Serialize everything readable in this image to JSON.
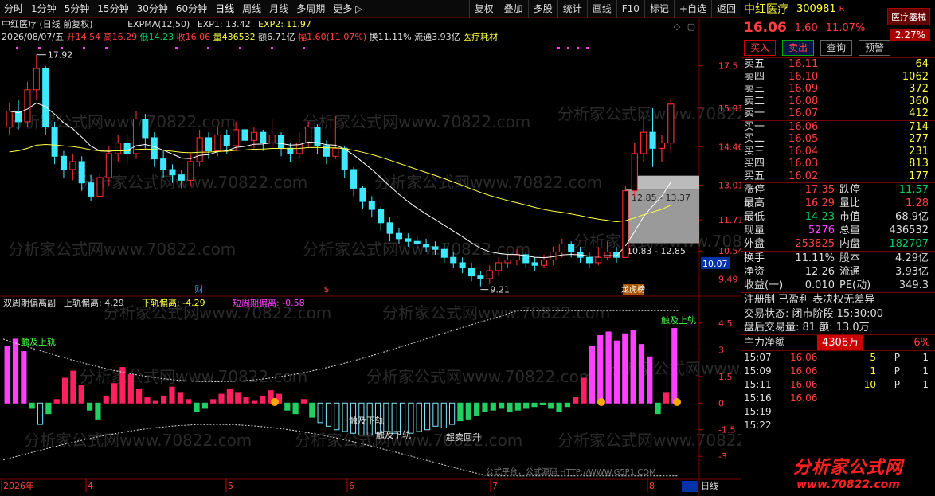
{
  "toolbar": {
    "left": [
      "分时",
      "1分钟",
      "5分钟",
      "15分钟",
      "30分钟",
      "60分钟",
      "日线",
      "周线",
      "月线",
      "多周期",
      "更多 ▷"
    ],
    "active_index": 6,
    "right": [
      "复权",
      "叠加",
      "多股",
      "统计",
      "画线",
      "F10",
      "标记",
      "+自选",
      "返回"
    ]
  },
  "info": {
    "title": "中红医疗 (日线 前复权)",
    "ema_label": "EXPMA(12,50)",
    "exp1": "EXP1: 13.42",
    "exp2": "EXP2: 11.97",
    "date": "2026/08/07/五",
    "open": "开14.54",
    "high": "高16.29",
    "low": "低14.23",
    "close": "收16.06",
    "vol": "量436532",
    "amount": "额6.71亿",
    "change": "幅1.60(11.07%)",
    "turnover": "换11.11%",
    "float": "流通3.93亿",
    "sector": "医疗耗材"
  },
  "chart_data": [
    {
      "type": "candlestick",
      "title": "",
      "price_axis": [
        17.5,
        15.91,
        14.46,
        13.01,
        11.71,
        10.54,
        9.49
      ],
      "ylim": [
        8.9,
        18.3
      ],
      "current_price_label": "10.07",
      "annotations": {
        "high_label": "17.92",
        "low_label": "9.21",
        "box_upper": "12.85 - 13.37",
        "box_lower": "10.83 - 12.85",
        "marks": [
          "财",
          "$",
          "龙虎榜"
        ]
      },
      "series": [
        {
          "name": "EXP1",
          "color": "#ffffff"
        },
        {
          "name": "EXP2",
          "color": "#ffff40"
        }
      ],
      "candles": [
        [
          15.2,
          15.8,
          16.1,
          14.9
        ],
        [
          15.8,
          15.4,
          16.2,
          15.1
        ],
        [
          15.4,
          16.6,
          16.9,
          15.2
        ],
        [
          16.6,
          17.4,
          17.92,
          16.2
        ],
        [
          17.4,
          15.2,
          17.5,
          14.9
        ],
        [
          15.2,
          14.1,
          15.4,
          13.8
        ],
        [
          14.1,
          13.6,
          14.3,
          13.3
        ],
        [
          13.6,
          13.9,
          14.2,
          13.2
        ],
        [
          13.9,
          13.1,
          14.1,
          12.8
        ],
        [
          13.1,
          12.6,
          13.4,
          12.4
        ],
        [
          12.6,
          13.3,
          13.5,
          12.4
        ],
        [
          13.3,
          14.2,
          14.5,
          13.0
        ],
        [
          14.2,
          14.6,
          14.9,
          13.9
        ],
        [
          14.6,
          14.2,
          14.9,
          13.8
        ],
        [
          14.2,
          15.5,
          15.8,
          14.0
        ],
        [
          15.5,
          14.8,
          15.7,
          14.4
        ],
        [
          14.8,
          14.0,
          15.0,
          13.7
        ],
        [
          14.0,
          13.6,
          14.3,
          13.3
        ],
        [
          13.6,
          13.4,
          13.8,
          13.1
        ],
        [
          13.4,
          13.2,
          13.6,
          12.9
        ],
        [
          13.2,
          13.9,
          14.2,
          13.0
        ],
        [
          13.9,
          14.8,
          15.1,
          13.7
        ],
        [
          14.8,
          14.3,
          15.0,
          14.0
        ],
        [
          14.3,
          14.9,
          15.2,
          14.1
        ],
        [
          14.9,
          14.5,
          15.1,
          14.2
        ],
        [
          14.5,
          15.1,
          15.4,
          14.3
        ],
        [
          15.1,
          14.7,
          15.3,
          14.4
        ],
        [
          14.7,
          15.0,
          15.2,
          14.4
        ],
        [
          15.0,
          14.6,
          15.1,
          14.3
        ],
        [
          14.6,
          14.9,
          15.5,
          14.4
        ],
        [
          14.9,
          14.4,
          15.0,
          14.1
        ],
        [
          14.4,
          14.2,
          14.6,
          13.9
        ],
        [
          14.2,
          14.6,
          15.0,
          14.0
        ],
        [
          14.6,
          15.2,
          15.4,
          14.4
        ],
        [
          15.2,
          14.5,
          15.3,
          14.2
        ],
        [
          14.5,
          14.1,
          14.7,
          13.8
        ],
        [
          14.1,
          14.4,
          15.6,
          14.0
        ],
        [
          14.4,
          13.6,
          14.5,
          13.3
        ],
        [
          13.6,
          12.9,
          13.7,
          12.6
        ],
        [
          12.9,
          12.4,
          13.0,
          12.1
        ],
        [
          12.4,
          12.1,
          12.6,
          11.8
        ],
        [
          12.1,
          11.6,
          12.2,
          11.3
        ],
        [
          11.6,
          11.2,
          11.8,
          10.9
        ],
        [
          11.2,
          11.0,
          11.4,
          10.8
        ],
        [
          11.0,
          10.9,
          11.2,
          10.7
        ],
        [
          10.9,
          10.8,
          11.1,
          10.6
        ],
        [
          10.8,
          10.7,
          11.0,
          10.5
        ],
        [
          10.7,
          10.6,
          10.9,
          10.4
        ],
        [
          10.6,
          10.3,
          10.8,
          10.1
        ],
        [
          10.3,
          10.1,
          10.5,
          9.9
        ],
        [
          10.1,
          9.9,
          10.3,
          9.7
        ],
        [
          9.9,
          9.6,
          10.1,
          9.4
        ],
        [
          9.6,
          9.5,
          9.8,
          9.21
        ],
        [
          9.5,
          9.8,
          10.0,
          9.3
        ],
        [
          9.8,
          10.1,
          10.3,
          9.6
        ],
        [
          10.1,
          10.2,
          10.4,
          9.9
        ],
        [
          10.2,
          10.4,
          10.6,
          10.0
        ],
        [
          10.4,
          10.1,
          10.5,
          9.9
        ],
        [
          10.1,
          10.0,
          10.3,
          9.8
        ],
        [
          10.0,
          10.2,
          10.4,
          9.9
        ],
        [
          10.2,
          10.5,
          10.7,
          10.0
        ],
        [
          10.5,
          10.8,
          11.0,
          10.3
        ],
        [
          10.8,
          10.5,
          10.9,
          10.3
        ],
        [
          10.5,
          10.3,
          10.7,
          10.1
        ],
        [
          10.3,
          10.1,
          10.5,
          9.9
        ],
        [
          10.1,
          10.3,
          10.7,
          10.0
        ],
        [
          10.3,
          10.5,
          10.9,
          10.2
        ],
        [
          10.5,
          10.3,
          10.7,
          10.1
        ],
        [
          10.3,
          12.8,
          13.0,
          10.9
        ],
        [
          12.8,
          14.2,
          14.6,
          12.6
        ],
        [
          14.2,
          15.0,
          15.6,
          13.9
        ],
        [
          15.0,
          14.4,
          15.9,
          13.7
        ],
        [
          14.4,
          14.6,
          14.9,
          13.9
        ],
        [
          14.6,
          16.06,
          16.29,
          14.23
        ]
      ]
    },
    {
      "type": "bar",
      "title": "双周期偏离副",
      "legend": [
        "上轨偏离: 4.29",
        "下轨偏离: -4.29",
        "短周期偏离: -0.58"
      ],
      "y_axis": [
        4.5,
        3.0,
        1.5,
        0.0,
        -1.5,
        -3.0
      ],
      "ylim": [
        -4.2,
        5.3
      ],
      "annotations": [
        "触及上轨",
        "触及下轨",
        "触及下轨",
        "超卖回升",
        "触及上轨"
      ],
      "values": [
        3.2,
        3.6,
        2.9,
        -0.3,
        -1.2,
        -0.6,
        0.2,
        1.4,
        1.8,
        1.0,
        -0.4,
        -0.9,
        0.4,
        1.1,
        2.0,
        1.6,
        0.8,
        0.3,
        0.1,
        0.4,
        0.9,
        0.6,
        0.2,
        -0.5,
        -0.3,
        0.2,
        0.5,
        0.8,
        0.6,
        0.3,
        0.1,
        0.4,
        0.7,
        0.5,
        -0.4,
        -0.6,
        0.2,
        -0.8,
        -1.1,
        -1.3,
        -1.5,
        -1.6,
        -1.7,
        -1.8,
        -1.8,
        -1.7,
        -1.6,
        -1.7,
        -1.8,
        -1.7,
        -1.6,
        -1.5,
        -1.3,
        -1.4,
        -1.2,
        -1.0,
        -0.9,
        -0.7,
        -0.5,
        -0.4,
        -0.3,
        -0.5,
        -0.4,
        -0.3,
        -0.2,
        -0.1,
        -0.3,
        -0.5,
        -0.2,
        0.3,
        1.4,
        3.2,
        3.8,
        4.0,
        3.5,
        3.9,
        4.1,
        3.3,
        2.6,
        -0.6,
        0.6,
        4.2
      ]
    }
  ],
  "bottom_axis": {
    "labels": [
      "2026年",
      "4",
      "5",
      "6",
      "7",
      "8"
    ],
    "period": "日线"
  },
  "watermark": "分析家公式网www.70822.com",
  "footer_watermark": "公式平台，公式源码  HTTP://WWW.G5P1.COM",
  "right_panel": {
    "name": "中红医疗",
    "code": "300981",
    "flag": "R",
    "industry": "医疗器械",
    "industry_pct": "2.27%",
    "price": "16.06",
    "change": "1.60",
    "change_pct": "11.07%",
    "buttons": [
      "买入",
      "卖出",
      "查询",
      "预警"
    ],
    "asks": [
      {
        "label": "卖五",
        "price": "16.11",
        "vol": "64"
      },
      {
        "label": "卖四",
        "price": "16.10",
        "vol": "1062"
      },
      {
        "label": "卖三",
        "price": "16.09",
        "vol": "372"
      },
      {
        "label": "卖二",
        "price": "16.08",
        "vol": "360"
      },
      {
        "label": "卖一",
        "price": "16.07",
        "vol": "412"
      }
    ],
    "bids": [
      {
        "label": "买一",
        "price": "16.06",
        "vol": "714"
      },
      {
        "label": "买二",
        "price": "16.05",
        "vol": "277"
      },
      {
        "label": "买三",
        "price": "16.04",
        "vol": "231"
      },
      {
        "label": "买四",
        "price": "16.03",
        "vol": "813"
      },
      {
        "label": "买五",
        "price": "16.02",
        "vol": "177"
      }
    ],
    "stats": [
      {
        "k": "涨停",
        "v": "17.35",
        "vc": "#ff4040",
        "k2": "跌停",
        "v2": "11.57",
        "v2c": "#00d060"
      },
      {
        "k": "最高",
        "v": "16.29",
        "vc": "#ff4040",
        "k2": "量比",
        "v2": "1.28",
        "v2c": "#ff4040"
      },
      {
        "k": "最低",
        "v": "14.23",
        "vc": "#00d060",
        "k2": "市值",
        "v2": "68.9亿",
        "v2c": "#dddddd"
      },
      {
        "k": "现量",
        "v": "5276",
        "vc": "#ff40ff",
        "k2": "总量",
        "v2": "436532",
        "v2c": "#dddddd"
      },
      {
        "k": "外盘",
        "v": "253825",
        "vc": "#ff4040",
        "k2": "内盘",
        "v2": "182707",
        "v2c": "#00d060"
      }
    ],
    "stats2": [
      {
        "k": "换手",
        "v": "11.11%",
        "k2": "股本",
        "v2": "4.29亿"
      },
      {
        "k": "净资",
        "v": "12.26",
        "k2": "流通",
        "v2": "3.93亿"
      },
      {
        "k": "收益(一)",
        "v": "0.010",
        "k2": "PE(动)",
        "v2": "349.3"
      }
    ],
    "reg_text": "注册制 已盈利 表决权无差异",
    "trade_status": "交易状态: 闭市阶段 15:30:00",
    "after_hours": "盘后交易量: 81  额: 13.0万",
    "main_flow_label": "主力净额",
    "main_flow_value": "4306万",
    "main_flow_pct": "6%",
    "ticks": [
      {
        "t": "15:07",
        "p": "16.06",
        "v": "5",
        "f": "P",
        "n": "1"
      },
      {
        "t": "15:09",
        "p": "16.06",
        "v": "1",
        "f": "P",
        "n": "1"
      },
      {
        "t": "15:11",
        "p": "16.06",
        "v": "10",
        "f": "P",
        "n": "1"
      },
      {
        "t": "15:16",
        "p": "16.06",
        "v": "",
        "f": "",
        "n": ""
      },
      {
        "t": "15:19",
        "p": "",
        "v": "",
        "f": "",
        "n": ""
      },
      {
        "t": "15:22",
        "p": "",
        "v": "",
        "f": "",
        "n": ""
      }
    ]
  },
  "logo": {
    "line1": "分析家公式网",
    "line2": "www.70822.com"
  }
}
